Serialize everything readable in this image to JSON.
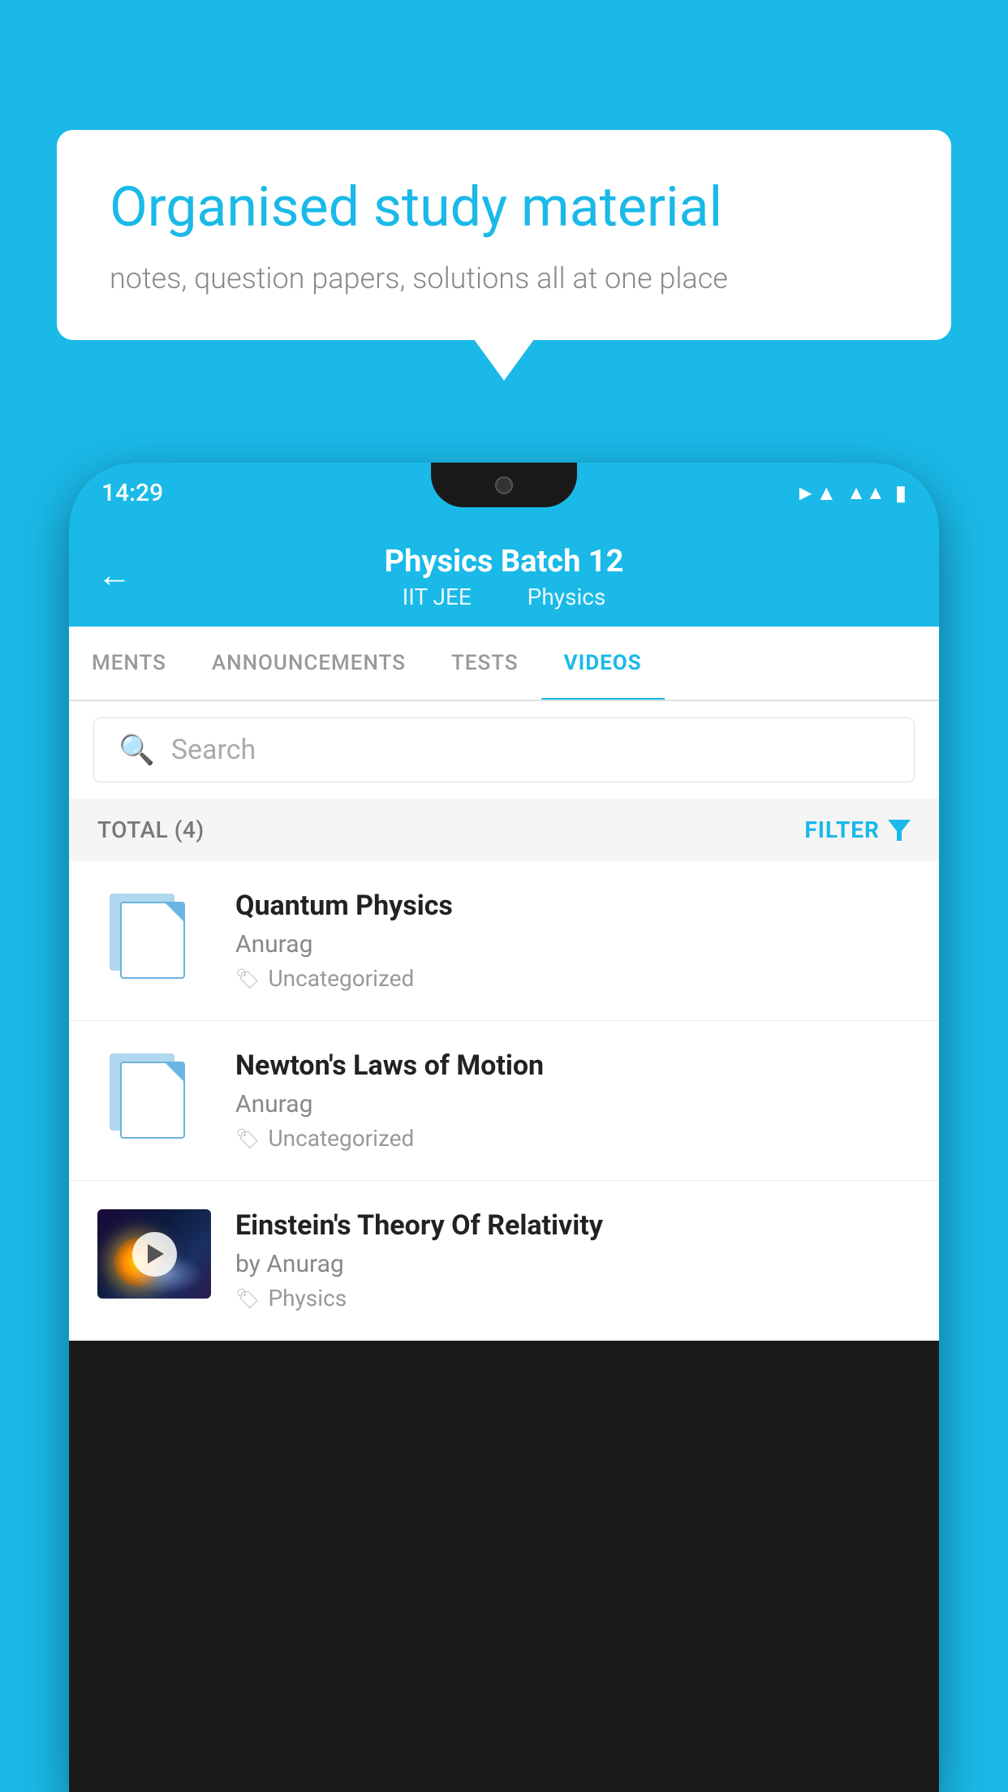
{
  "background_color": "#1ab9e8",
  "speech_bubble": {
    "title": "Organised study material",
    "subtitle": "notes, question papers, solutions all at one place"
  },
  "phone": {
    "status_bar": {
      "time": "14:29",
      "wifi": "▼",
      "signal": "▲",
      "battery": "▉"
    },
    "header": {
      "back_label": "←",
      "title": "Physics Batch 12",
      "subtitle_part1": "IIT JEE",
      "subtitle_part2": "Physics"
    },
    "tabs": [
      {
        "label": "MENTS",
        "active": false
      },
      {
        "label": "ANNOUNCEMENTS",
        "active": false
      },
      {
        "label": "TESTS",
        "active": false
      },
      {
        "label": "VIDEOS",
        "active": true
      }
    ],
    "search": {
      "placeholder": "Search"
    },
    "filter_bar": {
      "total_label": "TOTAL (4)",
      "filter_label": "FILTER"
    },
    "video_items": [
      {
        "id": 1,
        "title": "Quantum Physics",
        "author": "Anurag",
        "tag": "Uncategorized",
        "has_thumbnail": false
      },
      {
        "id": 2,
        "title": "Newton's Laws of Motion",
        "author": "Anurag",
        "tag": "Uncategorized",
        "has_thumbnail": false
      },
      {
        "id": 3,
        "title": "Einstein's Theory Of Relativity",
        "author": "by Anurag",
        "tag": "Physics",
        "has_thumbnail": true
      }
    ]
  }
}
